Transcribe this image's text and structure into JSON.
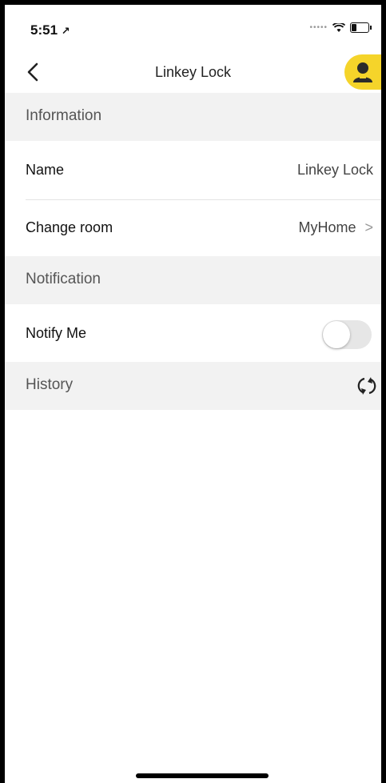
{
  "status_bar": {
    "time": "5:51",
    "location_glyph": "↗"
  },
  "nav": {
    "title": "Linkey Lock",
    "back_icon": "chevron-left-icon",
    "profile_icon": "person-icon",
    "accent": "#f5d42a"
  },
  "sections": {
    "information": {
      "header": "Information",
      "name_label": "Name",
      "name_value": "Linkey Lock",
      "room_label": "Change room",
      "room_value": "MyHome"
    },
    "notification": {
      "header": "Notification",
      "notify_label": "Notify Me",
      "notify_on": false
    },
    "history": {
      "header": "History",
      "refresh_icon": "refresh-icon"
    }
  }
}
